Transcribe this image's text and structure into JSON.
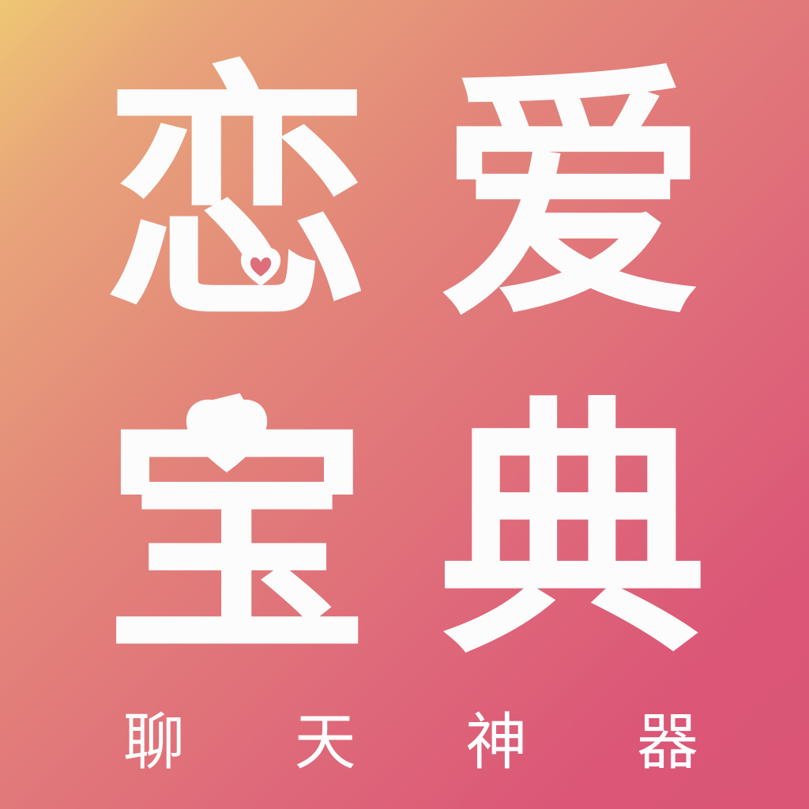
{
  "title": {
    "chars": [
      "恋",
      "爱",
      "宝",
      "典"
    ]
  },
  "subtitle": {
    "chars": [
      "聊",
      "天",
      "神",
      "器"
    ]
  },
  "colors": {
    "gradient_start": "#EEC774",
    "gradient_end": "#DA5576",
    "text": "#FCFCFC"
  },
  "icons": [
    "heart-icon"
  ]
}
